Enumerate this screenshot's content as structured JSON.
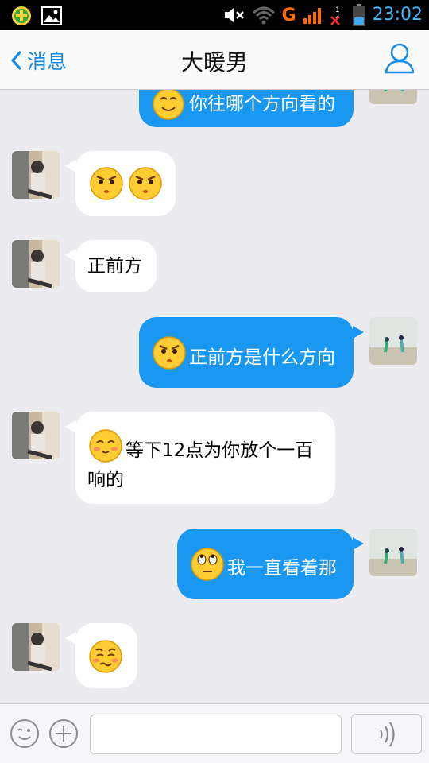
{
  "status_bar": {
    "time": "23:02",
    "network": "G",
    "sim1": "1",
    "sim2": "2"
  },
  "nav": {
    "back_label": "消息",
    "title": "大暖男"
  },
  "messages": [
    {
      "side": "out",
      "text": "你往哪个方向看的",
      "emoji": "smile-emoji"
    },
    {
      "side": "in",
      "text": "",
      "emoji": "glare-emoji"
    },
    {
      "side": "in",
      "text": "正前方"
    },
    {
      "side": "out",
      "text": "正前方是什么方向",
      "emoji": "glare-emoji"
    },
    {
      "side": "in",
      "text": "等下12点为你放个一百",
      "text2": "响的",
      "emoji": "shy-emoji"
    },
    {
      "side": "out",
      "text": "我一直看着那",
      "emoji": "rolling-eyes-emoji"
    },
    {
      "side": "in",
      "text": "",
      "emoji": "wronged-emoji"
    }
  ],
  "input": {
    "value": "",
    "placeholder": ""
  },
  "colors": {
    "outgoing_bubble": "#1a97f0",
    "incoming_bubble": "#ffffff",
    "accent": "#1589e6",
    "background": "#ebebf0"
  }
}
